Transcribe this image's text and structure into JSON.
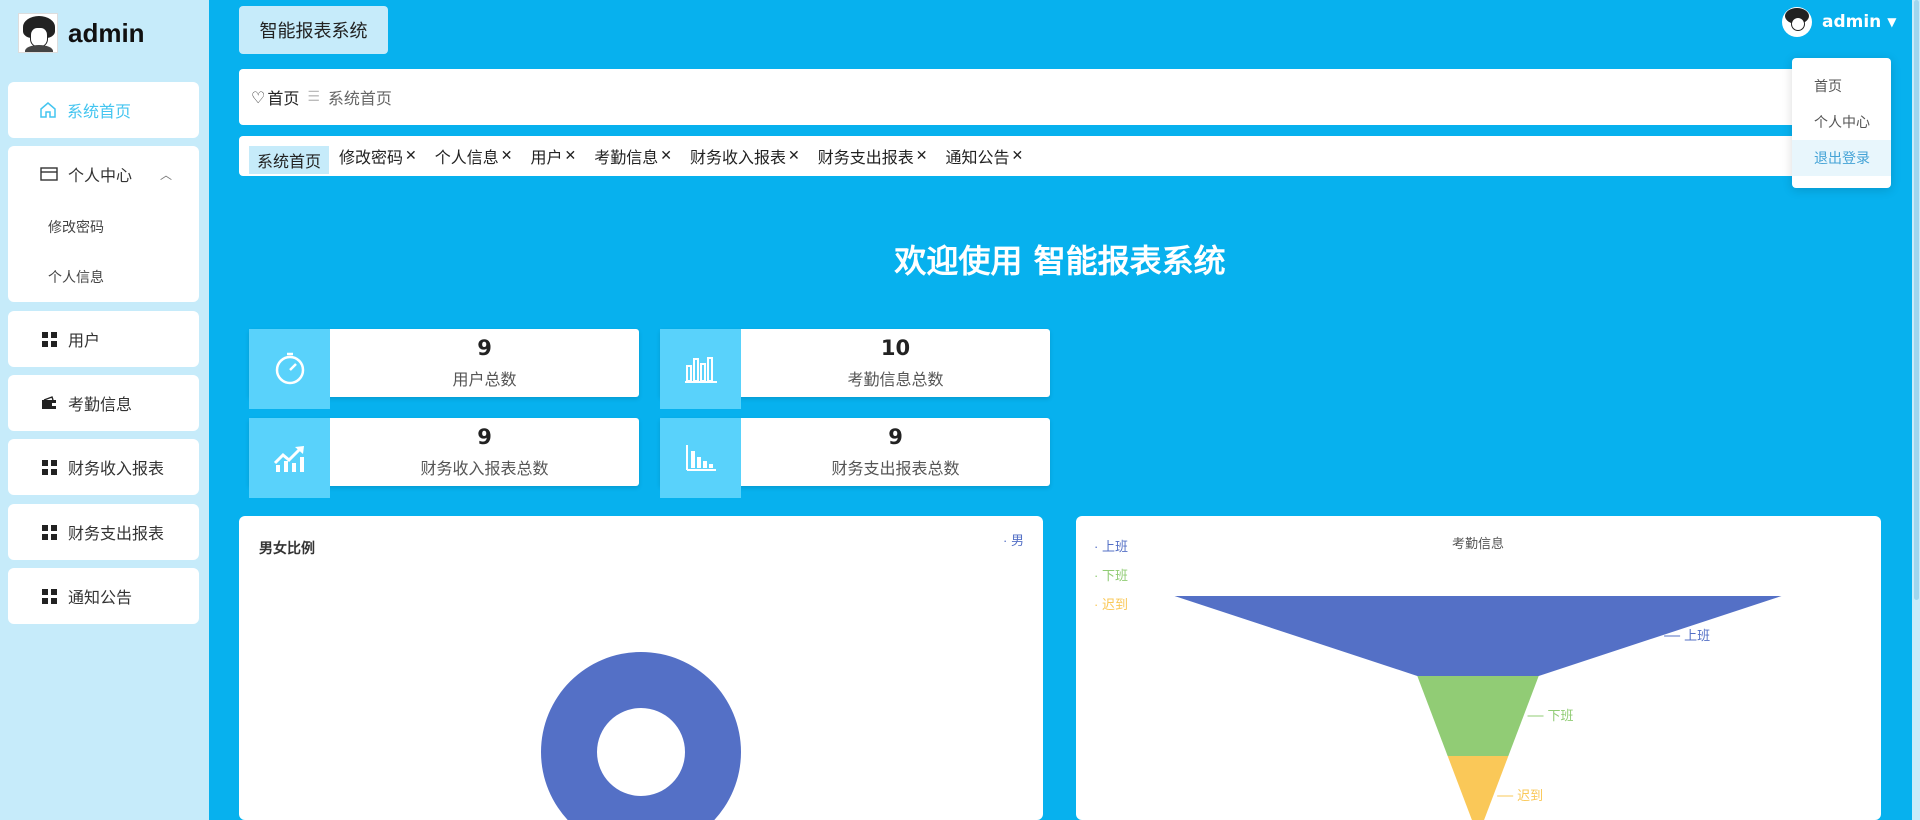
{
  "brand": {
    "title": "admin"
  },
  "sidebar": {
    "home": "系统首页",
    "personal": {
      "label": "个人中心",
      "children": [
        "修改密码",
        "个人信息"
      ]
    },
    "items": [
      "用户",
      "考勤信息",
      "财务收入报表",
      "财务支出报表",
      "通知公告"
    ]
  },
  "header": {
    "system_button": "智能报表系统",
    "user": "admin"
  },
  "dropdown": [
    "首页",
    "个人中心",
    "退出登录"
  ],
  "breadcrumb": {
    "home": "首页",
    "current": "系统首页"
  },
  "tabs": [
    {
      "label": "系统首页",
      "closable": false
    },
    {
      "label": "修改密码",
      "closable": true
    },
    {
      "label": "个人信息",
      "closable": true
    },
    {
      "label": "用户",
      "closable": true
    },
    {
      "label": "考勤信息",
      "closable": true
    },
    {
      "label": "财务收入报表",
      "closable": true
    },
    {
      "label": "财务支出报表",
      "closable": true
    },
    {
      "label": "通知公告",
      "closable": true
    }
  ],
  "welcome": "欢迎使用 智能报表系统",
  "stats": [
    {
      "value": "9",
      "label": "用户总数",
      "icon": "timer-icon"
    },
    {
      "value": "10",
      "label": "考勤信息总数",
      "icon": "bar-chart-icon"
    },
    {
      "value": "9",
      "label": "财务收入报表总数",
      "icon": "trend-up-icon"
    },
    {
      "value": "9",
      "label": "财务支出报表总数",
      "icon": "histogram-icon"
    }
  ],
  "colors": {
    "primary": "#07b1ee",
    "sidebar": "#c6ebfa",
    "accent": "#44c5f0",
    "blue": "#5470c6",
    "green": "#91cc75",
    "yellow": "#fac858"
  },
  "chart_data": [
    {
      "type": "pie",
      "title": "男女比例",
      "legend": [
        "男"
      ],
      "categories": [
        "男"
      ],
      "values": [
        1
      ],
      "donut": true
    },
    {
      "type": "funnel",
      "title": "考勤信息",
      "legend": [
        "上班",
        "下班",
        "迟到"
      ],
      "categories": [
        "上班",
        "下班",
        "迟到"
      ],
      "values": [
        100,
        20,
        10
      ]
    }
  ]
}
